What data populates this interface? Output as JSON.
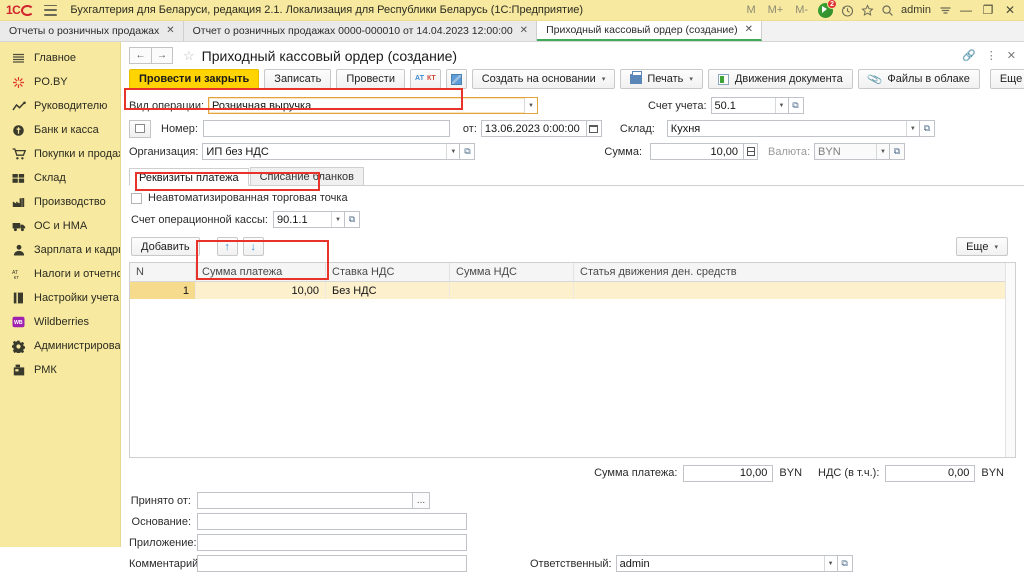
{
  "titlebar": {
    "app_title": "Бухгалтерия для Беларуси, редакция 2.1. Локализация для Республики Беларусь   (1С:Предприятие)",
    "logo": "1C",
    "m_buttons": [
      "M",
      "M+",
      "M-"
    ],
    "notification_count": "2",
    "username": "admin",
    "minimize": "—",
    "maximize": "❐",
    "close": "✕"
  },
  "tabs": [
    {
      "label": "Отчеты о розничных продажах",
      "active": false,
      "close": "✕"
    },
    {
      "label": "Отчет о розничных продажах 0000-000010 от 14.04.2023 12:00:00",
      "active": false,
      "close": "✕"
    },
    {
      "label": "Приходный кассовый ордер (создание)",
      "active": true,
      "close": "✕"
    }
  ],
  "sidebar": {
    "items": [
      {
        "label": "Главное",
        "icon": "menu-icon"
      },
      {
        "label": "PO.BY",
        "icon": "starburst-icon"
      },
      {
        "label": "Руководителю",
        "icon": "trend-up-icon"
      },
      {
        "label": "Банк и касса",
        "icon": "coin-icon"
      },
      {
        "label": "Покупки и продажи",
        "icon": "cart-icon"
      },
      {
        "label": "Склад",
        "icon": "warehouse-icon"
      },
      {
        "label": "Производство",
        "icon": "factory-icon"
      },
      {
        "label": "ОС и НМА",
        "icon": "truck-icon"
      },
      {
        "label": "Зарплата и кадры",
        "icon": "person-icon"
      },
      {
        "label": "Налоги и отчетность",
        "icon": "tax-icon"
      },
      {
        "label": "Настройки учета",
        "icon": "book-icon"
      },
      {
        "label": "Wildberries",
        "icon": "wildberries-icon"
      },
      {
        "label": "Администрирование",
        "icon": "gear-icon"
      },
      {
        "label": "РМК",
        "icon": "cashbox-icon"
      }
    ]
  },
  "document": {
    "back": "←",
    "forward": "→",
    "favorite_star": "☆",
    "title": "Приходный кассовый ордер (создание)",
    "link_icon": "🔗",
    "more_icon": "⋮",
    "close_icon": "✕"
  },
  "toolbar": {
    "post_and_close": "Провести и закрыть",
    "write": "Записать",
    "post": "Провести",
    "at_kt_icon_a": "АТ",
    "at_kt_icon_k": "КТ",
    "structure_icon": "structure-icon",
    "create_based_on": "Создать на основании",
    "print": "Печать",
    "document_movements": "Движения документа",
    "cloud_files": "Файлы в облаке",
    "more": "Еще",
    "help": "?",
    "caret": "▾"
  },
  "form": {
    "operation_type_label": "Вид операции:",
    "operation_type_value": "Розничная выручка",
    "number_label": "Номер:",
    "number_value": "",
    "date_prefix": "от:",
    "date_value": "13.06.2023  0:00:00",
    "organization_label": "Организация:",
    "organization_value": "ИП без НДС",
    "account_label": "Счет учета:",
    "account_value": "50.1",
    "warehouse_label": "Склад:",
    "warehouse_value": "Кухня",
    "amount_label": "Сумма:",
    "amount_value": "10,00",
    "currency_label": "Валюта:",
    "currency_value": "BYN"
  },
  "form_tabs": [
    {
      "label": "Реквизиты платежа",
      "active": true
    },
    {
      "label": "Списание бланков",
      "active": false
    }
  ],
  "payment_details": {
    "checkbox_label": "Неавтоматизированная торговая точка",
    "checkbox_checked": false,
    "cash_account_label": "Счет операционной кассы:",
    "cash_account_value": "90.1.1",
    "add_button": "Добавить",
    "move_up": "↑",
    "move_down": "↓",
    "more": "Еще",
    "caret": "▾"
  },
  "table": {
    "columns": [
      "N",
      "Сумма платежа",
      "Ставка НДС",
      "Сумма НДС",
      "Статья движения ден. средств"
    ],
    "rows": [
      {
        "n": "1",
        "payment_sum": "10,00",
        "vat_rate": "Без НДС",
        "vat_sum": "",
        "cashflow_item": "",
        "selected": true
      }
    ]
  },
  "totals": {
    "payment_sum_label": "Сумма платежа:",
    "payment_sum_value": "10,00",
    "payment_sum_currency": "BYN",
    "vat_label": "НДС (в т.ч.):",
    "vat_value": "0,00",
    "vat_currency": "BYN"
  },
  "footer": {
    "accepted_from_label": "Принято от:",
    "accepted_from_value": "",
    "basis_label": "Основание:",
    "basis_value": "",
    "attachment_label": "Приложение:",
    "attachment_value": "",
    "comment_label": "Комментарий:",
    "comment_value": "",
    "responsible_label": "Ответственный:",
    "responsible_value": "admin",
    "dots": "..."
  },
  "colors": {
    "accent_yellow": "#ffd400",
    "sidebar_bg": "#f7e9a0",
    "titlebar_bg": "#f7e9a0",
    "highlight_red": "#e8332a",
    "highlight_orange": "#e3a23a",
    "row_select": "#fdf0cc",
    "active_tab_underline": "#3faa5a"
  }
}
